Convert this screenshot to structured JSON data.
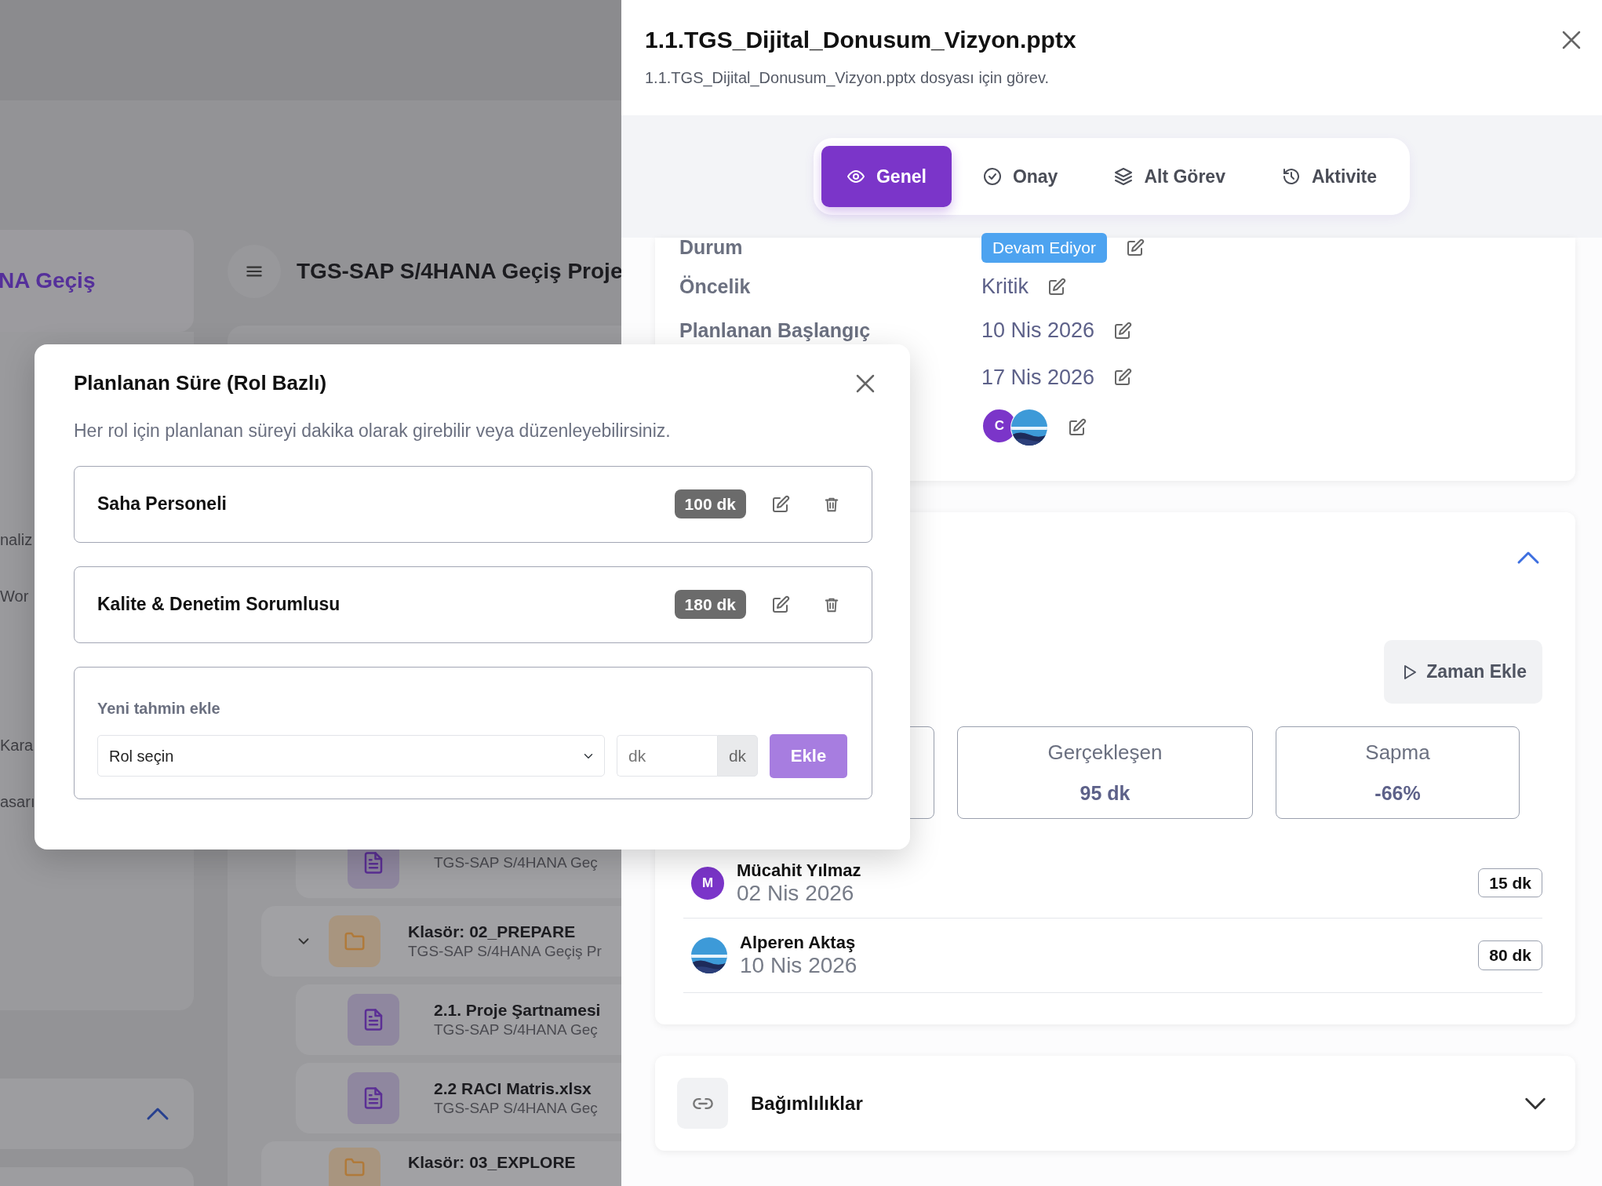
{
  "background": {
    "sidebar_title": "NA Geçiş",
    "page_title": "TGS-SAP S/4HANA Geçiş Proje",
    "sidebar_items": [
      "naliz",
      "Wor",
      "Kara",
      "asarı"
    ],
    "tree": [
      {
        "kind": "file",
        "subtitle": "TGS-SAP S/4HANA Geç"
      },
      {
        "kind": "folder",
        "title": "Klasör: 02_PREPARE",
        "subtitle": "TGS-SAP S/4HANA Geçiş Pr",
        "expanded": true,
        "children": [
          {
            "kind": "file",
            "title": "2.1. Proje Şartnamesi",
            "subtitle": "TGS-SAP S/4HANA Geç"
          },
          {
            "kind": "file",
            "title": "2.2 RACI Matris.xlsx",
            "subtitle": "TGS-SAP S/4HANA Geç"
          }
        ]
      },
      {
        "kind": "folder",
        "title": "Klasör: 03_EXPLORE"
      }
    ],
    "sidebar_section_expanded": true
  },
  "drawer": {
    "title": "1.1.TGS_Dijital_Donusum_Vizyon.pptx",
    "subtitle": "1.1.TGS_Dijital_Donusum_Vizyon.pptx dosyası için görev.",
    "tabs": [
      {
        "label": "Genel",
        "selected": true
      },
      {
        "label": "Onay",
        "selected": false
      },
      {
        "label": "Alt Görev",
        "selected": false
      },
      {
        "label": "Aktivite",
        "selected": false
      }
    ],
    "details": [
      {
        "kind": "badge",
        "label": "Durum",
        "value": "Devam Ediyor"
      },
      {
        "kind": "text",
        "label": "Öncelik",
        "value": "Kritik"
      },
      {
        "kind": "text",
        "label": "Planlanan Başlangıç",
        "value": "10 Nis 2026"
      },
      {
        "kind": "text",
        "value": "17 Nis 2026"
      },
      {
        "kind": "avatars",
        "avatars": [
          {
            "kind": "initials",
            "initials": "C",
            "color": "#7b35c9"
          },
          {
            "kind": "picture"
          }
        ]
      }
    ],
    "time": {
      "expanded": true,
      "add_button": "Zaman Ekle",
      "stats": [
        {
          "label": "Gerçekleşen",
          "value": "95 dk"
        },
        {
          "label": "Sapma",
          "value": "-66%"
        }
      ],
      "entries": [
        {
          "name": "Mücahit Yılmaz",
          "date": "02 Nis 2026",
          "duration": "15 dk",
          "avatar": {
            "kind": "initials",
            "initials": "M",
            "color": "#7b35c9"
          }
        },
        {
          "name": "Alperen Aktaş",
          "date": "10 Nis 2026",
          "duration": "80 dk",
          "avatar": {
            "kind": "picture"
          }
        }
      ]
    },
    "dependencies": {
      "title": "Bağımlılıklar",
      "expanded": false
    }
  },
  "modal": {
    "title": "Planlanan Süre (Rol Bazlı)",
    "description": "Her rol için planlanan süreyi dakika olarak girebilir veya düzenleyebilirsiniz.",
    "roles": [
      {
        "name": "Saha Personeli",
        "minutes": "100 dk"
      },
      {
        "name": "Kalite & Denetim Sorumlusu",
        "minutes": "180 dk"
      }
    ],
    "new_estimate": {
      "label": "Yeni tahmin ekle",
      "role_select": "Rol seçin",
      "minutes_placeholder": "dk",
      "unit": "dk",
      "button": "Ekle",
      "button_disabled": true
    }
  }
}
